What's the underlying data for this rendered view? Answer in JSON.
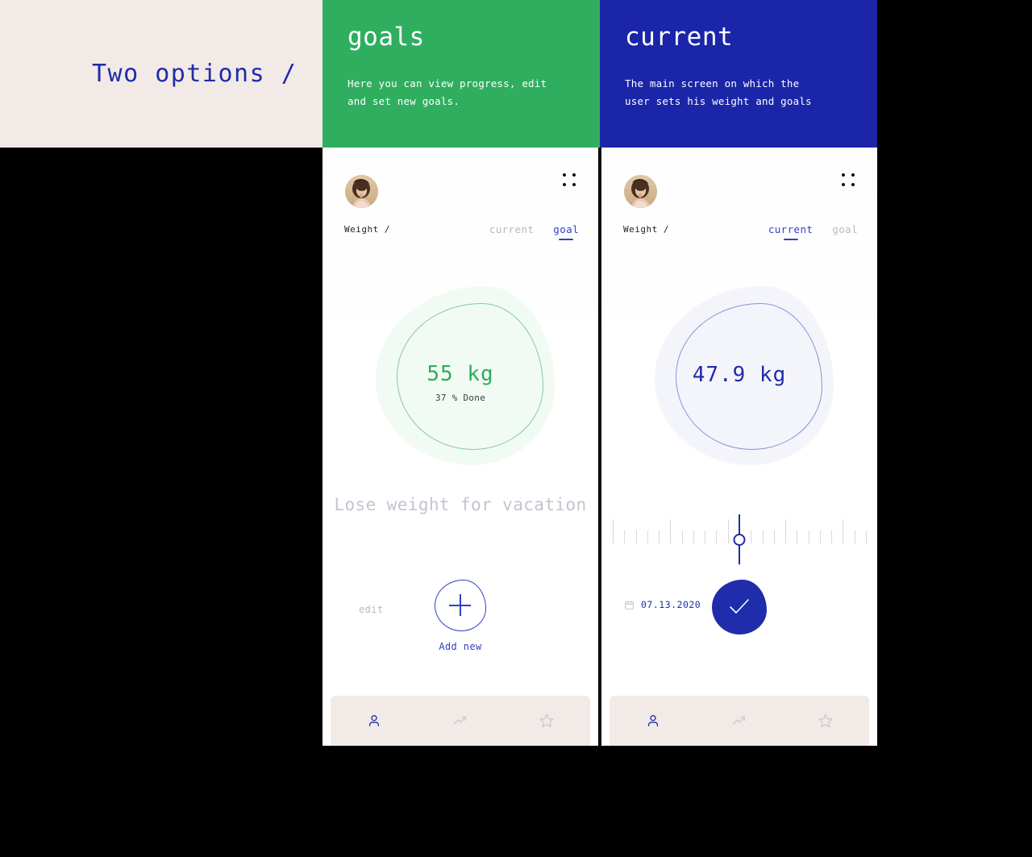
{
  "poster": {
    "headline": "Two options /",
    "headline_color": "#1f2cab",
    "beige": "#f2eae6"
  },
  "panels": [
    {
      "title": "goals",
      "description": "Here you can view progress, edit and set new goals.",
      "color": "#2fae5f"
    },
    {
      "title": "current",
      "description": "The main screen on which the user sets his weight and goals",
      "color": "#1b25a8"
    }
  ],
  "screens": {
    "goals": {
      "avatar": "user-avatar-photo",
      "menu_icon": "grid-dots-icon",
      "section_label": "Weight /",
      "tabs": [
        {
          "label": "current",
          "active": false
        },
        {
          "label": "goal",
          "active": true
        }
      ],
      "gauge": {
        "value": "55 kg",
        "sub": "37 % Done",
        "accent": "#2bad5e",
        "fill": "#f2faf4",
        "ring": "#83cba3"
      },
      "caption": "Lose weight for vacation",
      "edit_label": "edit",
      "add_icon": "plus-icon",
      "add_label": "Add new",
      "nav": [
        {
          "icon": "person-icon",
          "active": true
        },
        {
          "icon": "trending-up-icon",
          "active": false
        },
        {
          "icon": "star-icon",
          "active": false
        }
      ]
    },
    "current": {
      "avatar": "user-avatar-photo",
      "menu_icon": "grid-dots-icon",
      "section_label": "Weight /",
      "tabs": [
        {
          "label": "current",
          "active": true
        },
        {
          "label": "goal",
          "active": false
        }
      ],
      "gauge": {
        "value": "47.9 kg",
        "accent": "#1f2cab",
        "fill": "#f4f4fb",
        "ring": "#8d93d4"
      },
      "slider": {
        "name": "weight-ruler-slider",
        "tick_count": 23,
        "major_every": 5,
        "position_percent": 50
      },
      "date_icon": "calendar-icon",
      "date": "07.13.2020",
      "confirm_icon": "check-icon",
      "nav": [
        {
          "icon": "person-icon",
          "active": true
        },
        {
          "icon": "trending-up-icon",
          "active": false
        },
        {
          "icon": "star-icon",
          "active": false
        }
      ]
    }
  }
}
